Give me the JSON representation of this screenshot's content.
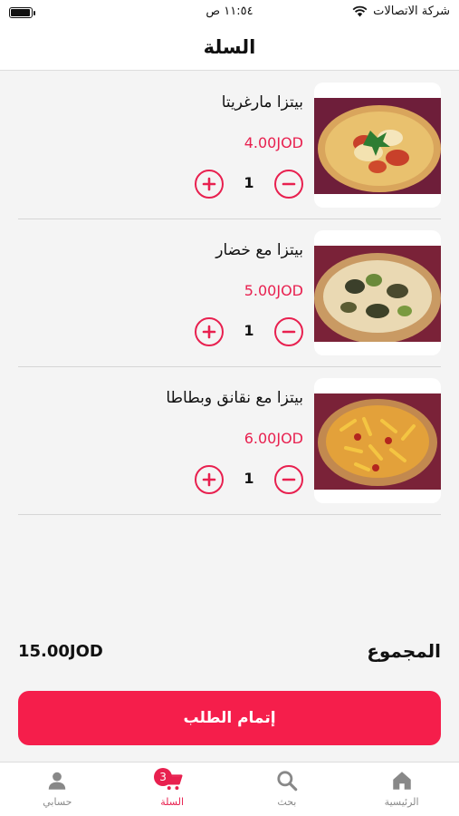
{
  "status_bar": {
    "carrier": "شركة الاتصالات",
    "time": "١١:٥٤ ص",
    "battery_level": 0.95
  },
  "header": {
    "title": "السلة"
  },
  "cart": {
    "items": [
      {
        "name": "بيتزا مارغريتا",
        "price": "4.00JOD",
        "quantity": "1"
      },
      {
        "name": "بيتزا مع خضار",
        "price": "5.00JOD",
        "quantity": "1"
      },
      {
        "name": "بيتزا مع نقانق وبطاطا",
        "price": "6.00JOD",
        "quantity": "1"
      }
    ]
  },
  "summary": {
    "total_label": "المجموع",
    "total_value": "15.00JOD"
  },
  "checkout": {
    "label": "إتمام الطلب"
  },
  "tabs": [
    {
      "label": "الرئيسية",
      "icon": "home-icon"
    },
    {
      "label": "بحث",
      "icon": "search-icon"
    },
    {
      "label": "السلة",
      "icon": "cart-icon",
      "badge": "3",
      "active": true
    },
    {
      "label": "حسابي",
      "icon": "user-icon"
    }
  ],
  "colors": {
    "accent": "#e8204f",
    "button": "#f51e4b",
    "inactive": "#888888"
  }
}
